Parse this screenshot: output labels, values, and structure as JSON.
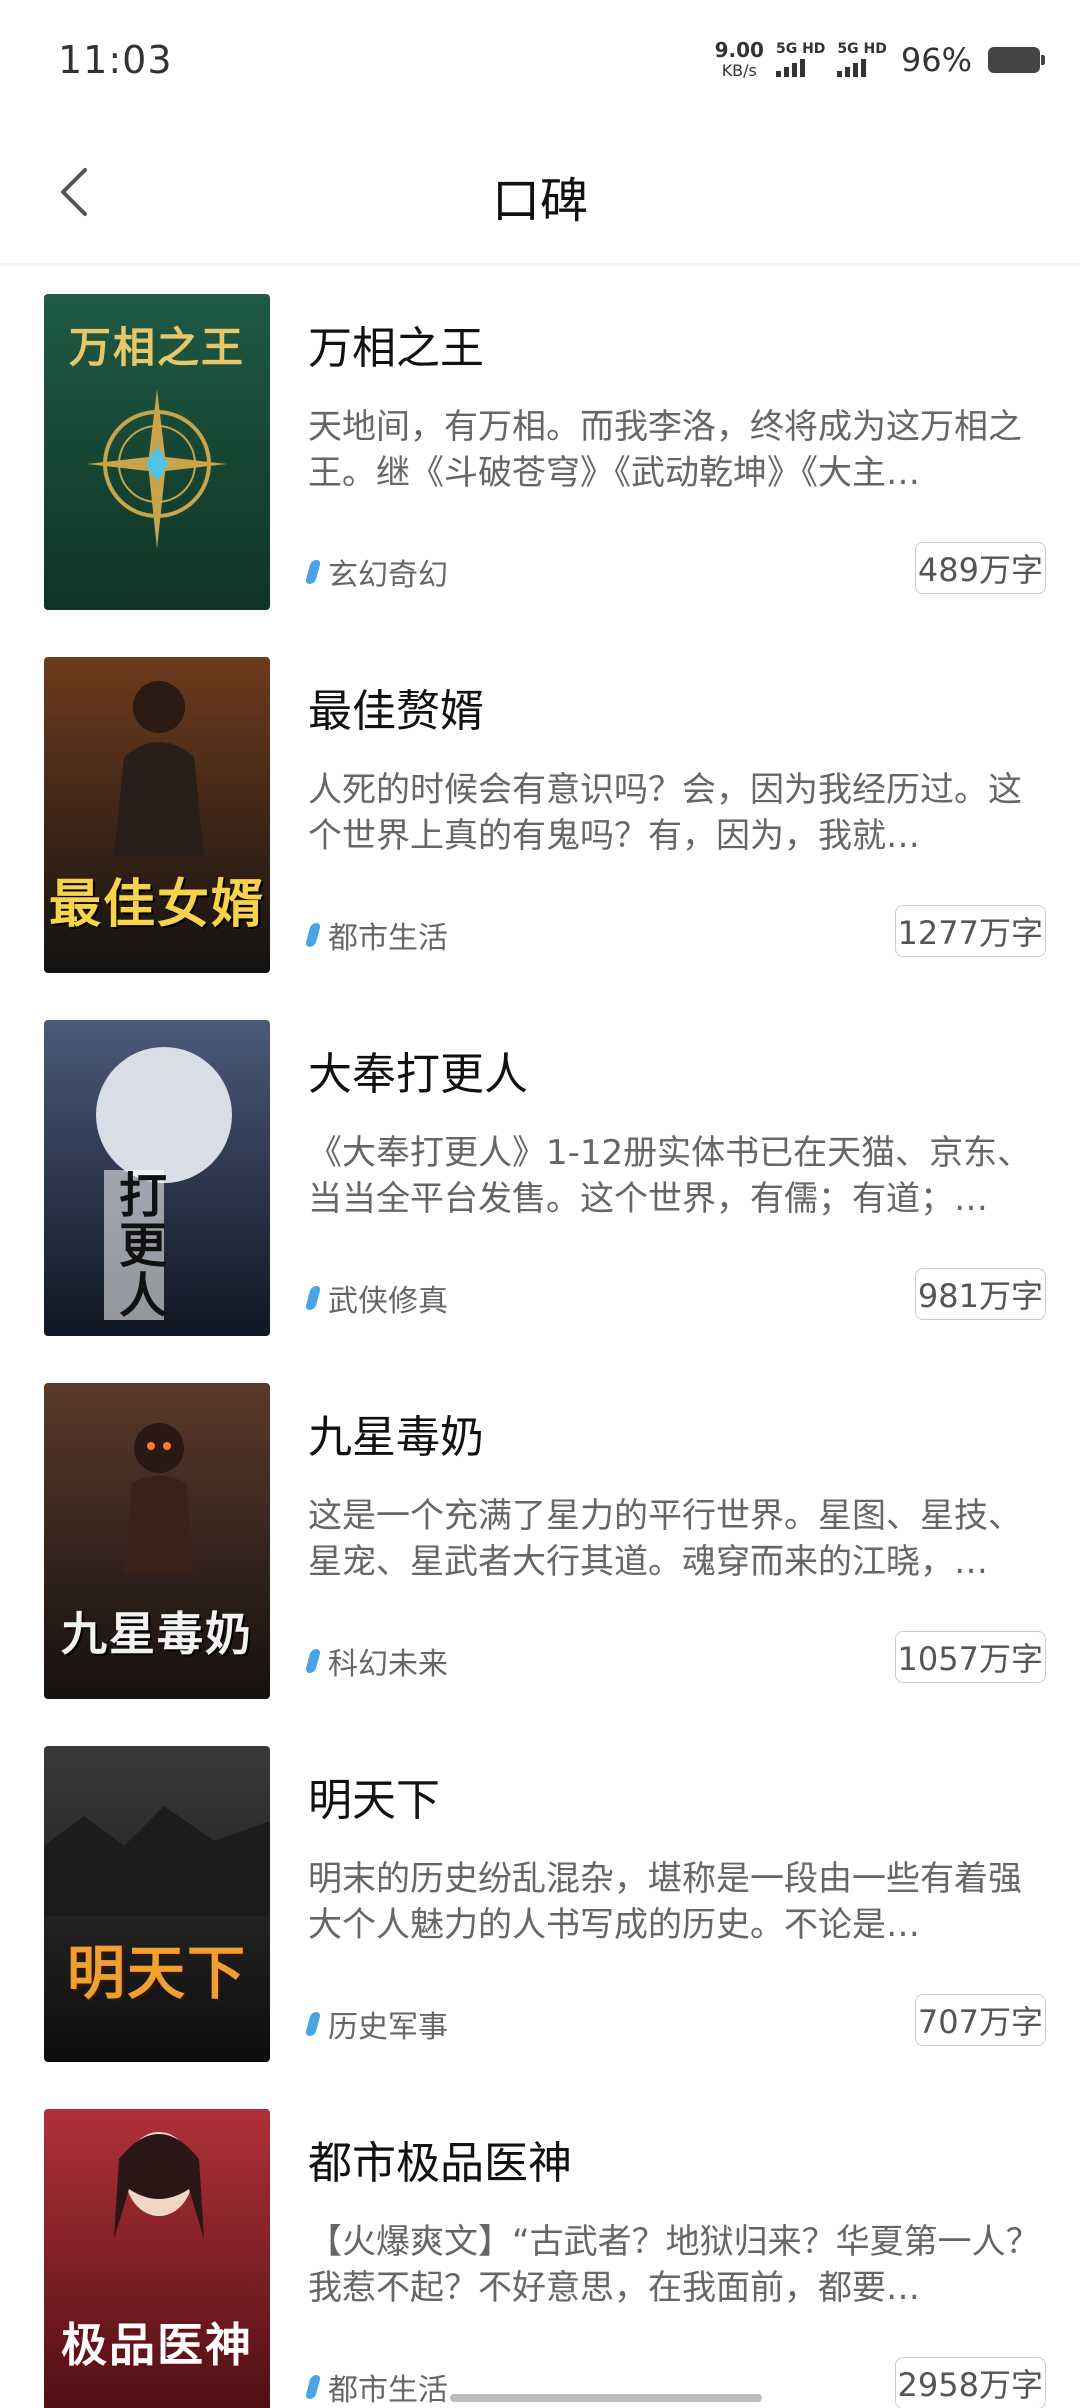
{
  "status_bar": {
    "time": "11:03",
    "net_speed_value": "9.00",
    "net_speed_unit": "KB/s",
    "sim1_label": "5G HD",
    "sim2_label": "5G HD",
    "battery_percent": "96%"
  },
  "header": {
    "title": "口碑",
    "back_icon": "chevron-left-icon"
  },
  "books": [
    {
      "title": "万相之王",
      "desc": "天地间，有万相。而我李洛，终将成为这万相之王。继《斗破苍穹》《武动乾坤》《大主…",
      "category": "玄幻奇幻",
      "words": "489万字",
      "cover_text": "万相之王",
      "cover_colors": [
        "#1f5a44",
        "#0e3426"
      ]
    },
    {
      "title": "最佳赘婿",
      "desc": "人死的时候会有意识吗？会，因为我经历过。这个世界上真的有鬼吗？有，因为，我就…",
      "category": "都市生活",
      "words": "1277万字",
      "cover_text": "最佳女婿",
      "cover_colors": [
        "#6e3b1c",
        "#121212"
      ]
    },
    {
      "title": "大奉打更人",
      "desc": "《大奉打更人》1-12册实体书已在天猫、京东、当当全平台发售。这个世界，有儒；有道；…",
      "category": "武侠修真",
      "words": "981万字",
      "cover_text": "打更人",
      "cover_colors": [
        "#4a5a7a",
        "#101522"
      ]
    },
    {
      "title": "九星毒奶",
      "desc": "这是一个充满了星力的平行世界。星图、星技、星宠、星武者大行其道。魂穿而来的江晓，…",
      "category": "科幻未来",
      "words": "1057万字",
      "cover_text": "九星毒奶",
      "cover_colors": [
        "#5a3a2a",
        "#151010"
      ]
    },
    {
      "title": "明天下",
      "desc": "明末的历史纷乱混杂，堪称是一段由一些有着强大个人魅力的人书写成的历史。不论是…",
      "category": "历史军事",
      "words": "707万字",
      "cover_text": "明天下",
      "cover_colors": [
        "#3a3a3a",
        "#0d0d0d"
      ]
    },
    {
      "title": "都市极品医神",
      "desc": "【火爆爽文】“古武者？地狱归来？华夏第一人？我惹不起？不好意思，在我面前，都要…",
      "category": "都市生活",
      "words": "2958万字",
      "cover_text": "极品医神",
      "cover_colors": [
        "#b0303a",
        "#4a0e12"
      ]
    }
  ],
  "colors": {
    "tag_accent": "#4aa3e6"
  }
}
